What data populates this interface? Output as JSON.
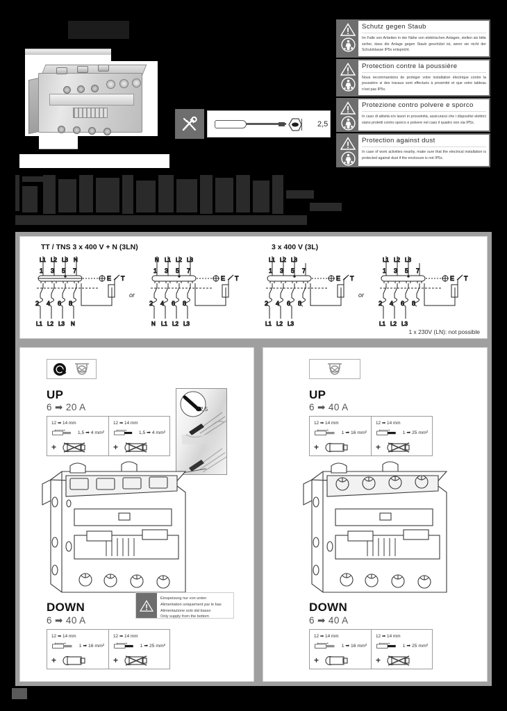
{
  "document": {
    "type": "installation-instruction-sheet",
    "tool_dimension": "2,5"
  },
  "warnings": [
    {
      "lang": "de",
      "title": "Schutz gegen Staub",
      "text": "Im Falle von Arbeiten in der Nähe von elektrischen Anlagen, stellen sie bitte sicher, dass die Anlage gegen Staub geschützt ist, wenn sie nicht der Schutzklasse IP5x entspricht.",
      "icon_warning": "warning-triangle-icon",
      "icon_dust": "dust-protection-icon"
    },
    {
      "lang": "fr",
      "title": "Protection contre la poussière",
      "text": "Nous recommandons de protéger votre installation électrique contre la poussière si des travaux sont effectués à proximité et que votre tableau n'est pas IP5x.",
      "icon_warning": "warning-triangle-icon",
      "icon_dust": "dust-protection-icon"
    },
    {
      "lang": "it",
      "title": "Protezione contro polvere e sporco",
      "text": "In caso di attività e/o lavori in prossimità, assicurarsi che i dispositivi elettrici siano protetti contro sporco e polvere nel caso il quadro non sia IP5x.",
      "icon_warning": "warning-triangle-icon",
      "icon_dust": "dust-protection-icon"
    },
    {
      "lang": "en",
      "title": "Protection against dust",
      "text": "In case of work activities nearby, make sure that the electrical installation is protected against dust if the enclosure is not IP5x.",
      "icon_warning": "warning-triangle-icon",
      "icon_dust": "dust-protection-icon"
    }
  ],
  "wiring": {
    "left_title": "TT / TNS 3 x 400 V + N (3LN)",
    "right_title": "3 x 400 V (3L)",
    "or_label": "or",
    "note": "1 x 230V (LN): not possible",
    "diagrams": [
      {
        "top_labels": [
          "L1",
          "L2",
          "L3",
          "N"
        ],
        "terminal_top": [
          "1",
          "3",
          "5",
          "7"
        ],
        "terminal_bottom": [
          "2",
          "4",
          "6",
          "8"
        ],
        "bottom_labels": [
          "L1",
          "L2",
          "L3",
          "N"
        ],
        "test": "T",
        "earth": "E"
      },
      {
        "top_labels": [
          "N",
          "L1",
          "L2",
          "L3"
        ],
        "terminal_top": [
          "1",
          "3",
          "5",
          "7"
        ],
        "terminal_bottom": [
          "2",
          "4",
          "6",
          "8"
        ],
        "bottom_labels": [
          "N",
          "L1",
          "L2",
          "L3"
        ],
        "test": "T",
        "earth": "E"
      },
      {
        "top_labels": [
          "L1",
          "L2",
          "L3"
        ],
        "terminal_top": [
          "1",
          "3",
          "5",
          "7"
        ],
        "terminal_bottom": [
          "2",
          "4",
          "6",
          "8"
        ],
        "bottom_labels": [
          "L1",
          "L2",
          "L3"
        ],
        "test": "T",
        "earth": "E"
      },
      {
        "top_labels": [
          "L1",
          "L2",
          "L3"
        ],
        "terminal_top": [
          "1",
          "3",
          "5",
          "7"
        ],
        "terminal_bottom": [
          "2",
          "4",
          "6",
          "8"
        ],
        "bottom_labels": [
          "L1",
          "L2",
          "L3"
        ],
        "test": "T",
        "earth": "E"
      }
    ]
  },
  "panel_left": {
    "badges": [
      "quick-connect-icon",
      "cage-terminal-icon"
    ],
    "up": {
      "title": "UP",
      "range": "6 ➡ 20 A",
      "cells": [
        {
          "strip": "12 ➡ 14 mm",
          "size": "1,5 ➡ 4 mm²",
          "ferrule_allowed": false,
          "wire_type": "stranded"
        },
        {
          "strip": "12 ➡ 14 mm",
          "size": "1,5 ➡ 4 mm²",
          "ferrule_allowed": false,
          "wire_type": "solid"
        }
      ]
    },
    "down": {
      "title": "DOWN",
      "range": "6 ➡ 40 A",
      "cells": [
        {
          "strip": "12 ➡ 14 mm",
          "size": "1 ➡ 16 mm²",
          "ferrule_allowed": true,
          "wire_type": "stranded"
        },
        {
          "strip": "12 ➡ 14 mm",
          "size": "1 ➡ 25 mm²",
          "ferrule_allowed": false,
          "wire_type": "solid"
        }
      ]
    },
    "note": {
      "icon": "warning-triangle-icon",
      "lines": [
        "Einspeisung nur von unten",
        "Alimentation uniquement par le bas",
        "Alimentazione solo dal basso",
        "Only supply from the bottom"
      ]
    },
    "callout": {
      "tool_label": "2,5",
      "icon": "screwdriver-icon"
    }
  },
  "panel_right": {
    "badges": [
      "cage-terminal-icon"
    ],
    "up": {
      "title": "UP",
      "range": "6 ➡ 40 A",
      "cells": [
        {
          "strip": "12 ➡ 14 mm",
          "size": "1 ➡ 16 mm²",
          "ferrule_allowed": true,
          "wire_type": "stranded"
        },
        {
          "strip": "12 ➡ 14 mm",
          "size": "1 ➡ 25 mm²",
          "ferrule_allowed": false,
          "wire_type": "solid"
        }
      ]
    },
    "down": {
      "title": "DOWN",
      "range": "6 ➡ 40 A",
      "cells": [
        {
          "strip": "12 ➡ 14 mm",
          "size": "1 ➡ 16 mm²",
          "ferrule_allowed": true,
          "wire_type": "stranded"
        },
        {
          "strip": "12 ➡ 14 mm",
          "size": "1 ➡ 25 mm²",
          "ferrule_allowed": false,
          "wire_type": "solid"
        }
      ]
    }
  }
}
